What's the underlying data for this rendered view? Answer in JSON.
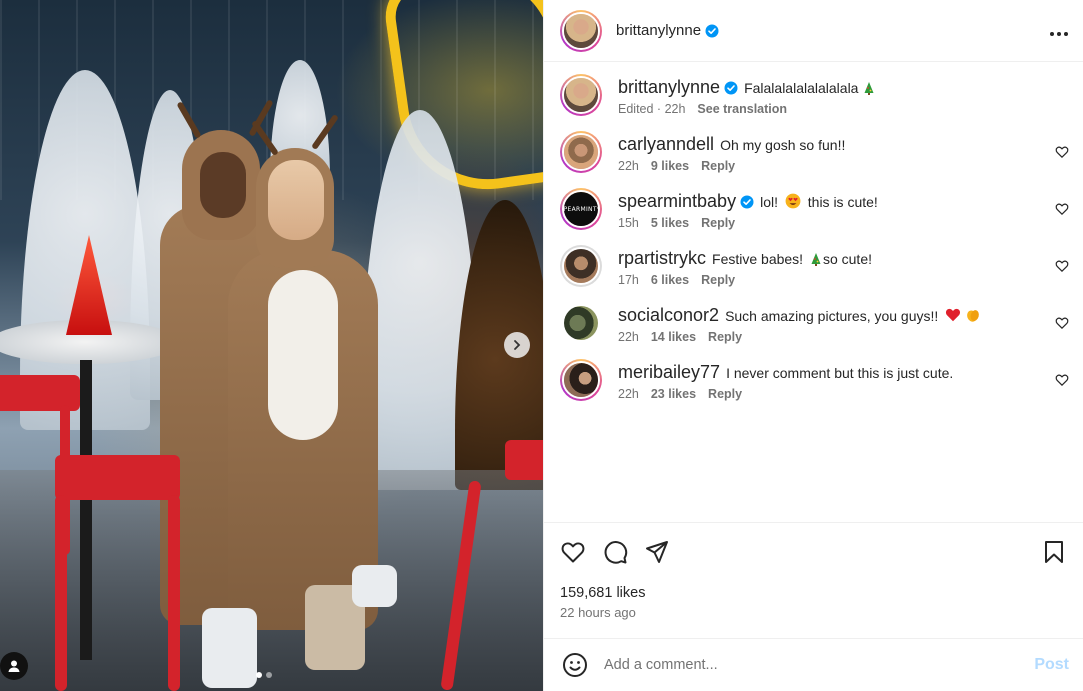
{
  "post": {
    "author": "brittanylynne",
    "verified": true,
    "more_icon": "more-horizontal-icon",
    "carousel": {
      "slide_count": 2,
      "active_index": 0
    }
  },
  "caption": {
    "username": "brittanylynne",
    "text": "Falalalalalalalalala",
    "edited_label": "Edited",
    "time": "22h",
    "translate_label": "See translation"
  },
  "comments": [
    {
      "username": "carlyanndell",
      "verified": false,
      "text": "Oh my gosh so fun!!",
      "time": "22h",
      "likes": "9 likes",
      "reply": "Reply"
    },
    {
      "username": "spearmintbaby",
      "verified": true,
      "text_before": "lol!",
      "text_after": "this is cute!",
      "avatar_text": "SPEARMINT♥",
      "time": "15h",
      "likes": "5 likes",
      "reply": "Reply"
    },
    {
      "username": "rpartistrykc",
      "verified": false,
      "text_before": "Festive babes!",
      "text_after": "so cute!",
      "time": "17h",
      "likes": "6 likes",
      "reply": "Reply"
    },
    {
      "username": "socialconor2",
      "verified": false,
      "text": "Such amazing pictures, you guys!!",
      "time": "22h",
      "likes": "14 likes",
      "reply": "Reply"
    },
    {
      "username": "meribailey77",
      "verified": false,
      "text": "I never comment but this is just cute.",
      "time": "22h",
      "likes": "23 likes",
      "reply": "Reply"
    }
  ],
  "actions": {
    "like_icon": "heart-icon",
    "comment_icon": "comment-icon",
    "share_icon": "share-icon",
    "save_icon": "bookmark-icon"
  },
  "stats": {
    "likes": "159,681 likes",
    "time_ago": "22 hours ago"
  },
  "composer": {
    "placeholder": "Add a comment...",
    "post_label": "Post"
  },
  "colors": {
    "verified": "#0095f6",
    "muted": "#737373",
    "post_disabled": "#b3dbff",
    "text": "#262626"
  }
}
